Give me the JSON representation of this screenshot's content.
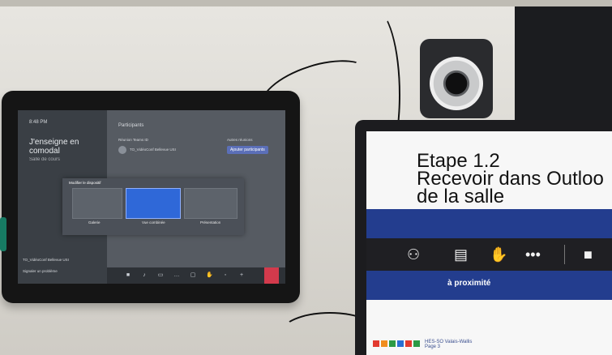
{
  "left_tablet": {
    "header_small": "8:48 PM",
    "room_title": "J'enseigne en comodal",
    "room_subtitle": "Salle de cours",
    "right_header": "Participants",
    "meeting_label": "Réunion Teams ID",
    "device_name": "TO_VidéoConf Bellevue USI",
    "mic_label": "Autres réunions",
    "add_button": "Ajouter participants",
    "dialog": {
      "title": "Modifier le dispositif",
      "options": [
        {
          "label": "Galerie"
        },
        {
          "label": "Vue combinée"
        },
        {
          "label": "Présentation"
        }
      ]
    },
    "bottom_device": "TO_VidéoConf Bellevue USI",
    "bottom_hint": "Signaler un problème",
    "toolbar_icons": [
      "camera-icon",
      "mic-icon",
      "share-icon",
      "more-icon",
      "layout-icon",
      "raise-hand-icon",
      "volume-icon",
      "add-icon",
      "hangup-icon"
    ]
  },
  "right_tablet": {
    "slide_title_line1": "Etape 1.2",
    "slide_title_line2": "Recevoir dans Outloo",
    "slide_title_line3": "de la salle",
    "proximity_text": "à proximité",
    "logo_text_1": "HES-SO Valais-Wallis",
    "logo_text_2": "Page 3",
    "teams_icons": [
      "people-icon",
      "chat-icon",
      "raise-hand-icon",
      "more-icon",
      "camera-icon"
    ],
    "logo_colors": [
      "#e23a2f",
      "#f08d1e",
      "#2c9a45",
      "#2b6fd2",
      "#e23a2f",
      "#2c9a45"
    ]
  }
}
